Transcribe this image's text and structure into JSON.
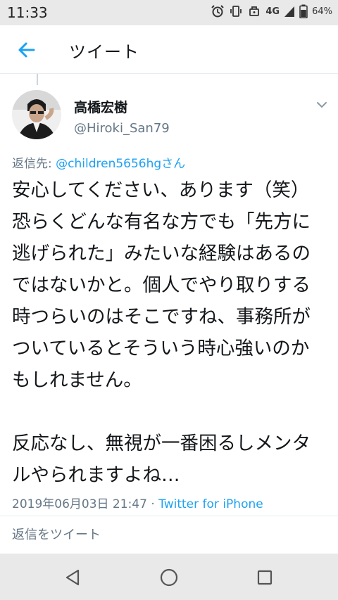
{
  "status_bar": {
    "time": "11:33",
    "network": "4G",
    "battery": "64%",
    "icons": [
      "alarm-icon",
      "vibrate-icon",
      "data-saver-icon",
      "signal-icon",
      "battery-icon"
    ]
  },
  "header": {
    "title": "ツイート",
    "back_icon": "arrow-left-icon",
    "accent_color": "#1da1f2"
  },
  "tweet": {
    "author_name": "高橋宏樹",
    "author_handle": "@Hiroki_San79",
    "reply_prefix": "返信先: ",
    "reply_target": "@children5656hgさん",
    "body": "安心してください、あります（笑）恐らくどんな有名な方でも「先方に逃げられた」みたいな経験はあるのではないかと。個人でやり取りする時つらいのはそこですね、事務所がついているとそういう時心強いのかもしれません。\n\n反応なし、無視が一番困るしメンタルやられますよね…",
    "timestamp": "2019年06月03日 21:47",
    "separator": " · ",
    "source": "Twitter for iPhone"
  },
  "reply_box": {
    "placeholder": "返信をツイート"
  },
  "nav_bar": {
    "buttons": [
      "back-triangle-icon",
      "home-circle-icon",
      "recents-square-icon"
    ]
  }
}
